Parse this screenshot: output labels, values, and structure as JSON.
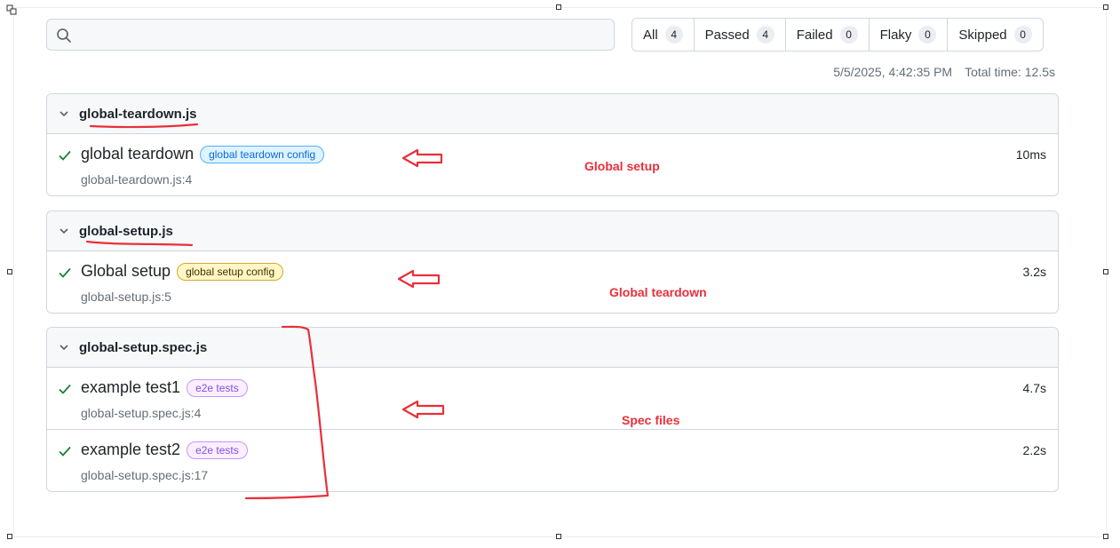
{
  "search": {
    "value": "",
    "placeholder": ""
  },
  "filters": [
    {
      "label": "All",
      "count": "4"
    },
    {
      "label": "Passed",
      "count": "4"
    },
    {
      "label": "Failed",
      "count": "0"
    },
    {
      "label": "Flaky",
      "count": "0"
    },
    {
      "label": "Skipped",
      "count": "0"
    }
  ],
  "meta": {
    "datetime": "5/5/2025, 4:42:35 PM",
    "total_time": "Total time: 12.5s"
  },
  "groups": [
    {
      "file": "global-teardown.js",
      "tests": [
        {
          "title": "global teardown",
          "tag": "global teardown config",
          "location": "global-teardown.js:4",
          "duration": "10ms"
        }
      ]
    },
    {
      "file": "global-setup.js",
      "tests": [
        {
          "title": "Global setup",
          "tag": "global setup config",
          "location": "global-setup.js:5",
          "duration": "3.2s"
        }
      ]
    },
    {
      "file": "global-setup.spec.js",
      "tests": [
        {
          "title": "example test1",
          "tag": "e2e tests",
          "location": "global-setup.spec.js:4",
          "duration": "4.7s"
        },
        {
          "title": "example test2",
          "tag": "e2e tests",
          "location": "global-setup.spec.js:17",
          "duration": "2.2s"
        }
      ]
    }
  ],
  "annotations": [
    "Global setup",
    "Global teardown",
    "Spec files"
  ],
  "colors": {
    "accent_red": "#e8303a",
    "pass_green": "#1a7f37"
  }
}
